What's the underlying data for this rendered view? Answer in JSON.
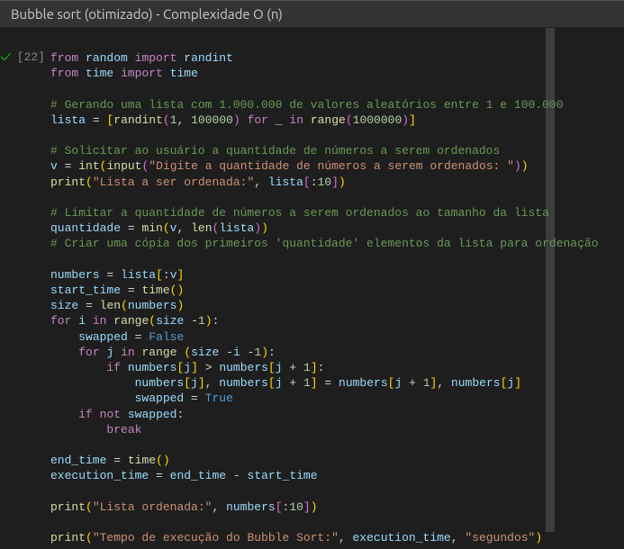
{
  "header": {
    "title": "Bubble sort (otimizado) - Complexidade O (n)"
  },
  "cell": {
    "execution_count_label": "[22]",
    "status_icon": "check",
    "code_tokens": [
      [
        [
          "kw",
          "from"
        ],
        [
          "op",
          " "
        ],
        [
          "var",
          "random"
        ],
        [
          "op",
          " "
        ],
        [
          "kw",
          "import"
        ],
        [
          "op",
          " "
        ],
        [
          "var",
          "randint"
        ]
      ],
      [
        [
          "kw",
          "from"
        ],
        [
          "op",
          " "
        ],
        [
          "var",
          "time"
        ],
        [
          "op",
          " "
        ],
        [
          "kw",
          "import"
        ],
        [
          "op",
          " "
        ],
        [
          "var",
          "time"
        ]
      ],
      [],
      [
        [
          "cmt",
          "# Gerando uma lista com 1.000.000 de valores aleatórios entre 1 e 100.000"
        ]
      ],
      [
        [
          "var",
          "lista"
        ],
        [
          "op",
          " "
        ],
        [
          "op",
          "="
        ],
        [
          "op",
          " "
        ],
        [
          "par",
          "["
        ],
        [
          "fn",
          "randint"
        ],
        [
          "brk",
          "("
        ],
        [
          "num",
          "1"
        ],
        [
          "op",
          ","
        ],
        [
          "op",
          " "
        ],
        [
          "num",
          "100000"
        ],
        [
          "brk",
          ")"
        ],
        [
          "op",
          " "
        ],
        [
          "kw",
          "for"
        ],
        [
          "op",
          " "
        ],
        [
          "var",
          "_"
        ],
        [
          "op",
          " "
        ],
        [
          "kw",
          "in"
        ],
        [
          "op",
          " "
        ],
        [
          "fn",
          "range"
        ],
        [
          "brk",
          "("
        ],
        [
          "num",
          "1000000"
        ],
        [
          "brk",
          ")"
        ],
        [
          "par",
          "]"
        ]
      ],
      [],
      [
        [
          "cmt",
          "# Solicitar ao usuário a quantidade de números a serem ordenados"
        ]
      ],
      [
        [
          "var",
          "v"
        ],
        [
          "op",
          " "
        ],
        [
          "op",
          "="
        ],
        [
          "op",
          " "
        ],
        [
          "fn",
          "int"
        ],
        [
          "par",
          "("
        ],
        [
          "fn",
          "input"
        ],
        [
          "brk",
          "("
        ],
        [
          "str",
          "\"Digite a quantidade de números a serem ordenados: \""
        ],
        [
          "brk",
          ")"
        ],
        [
          "par",
          ")"
        ]
      ],
      [
        [
          "fn",
          "print"
        ],
        [
          "par",
          "("
        ],
        [
          "str",
          "\"Lista a ser ordenada:\""
        ],
        [
          "op",
          ","
        ],
        [
          "op",
          " "
        ],
        [
          "var",
          "lista"
        ],
        [
          "brk",
          "["
        ],
        [
          "op",
          ":"
        ],
        [
          "num",
          "10"
        ],
        [
          "brk",
          "]"
        ],
        [
          "par",
          ")"
        ]
      ],
      [],
      [
        [
          "cmt",
          "# Limitar a quantidade de números a serem ordenados ao tamanho da lista"
        ]
      ],
      [
        [
          "var",
          "quantidade"
        ],
        [
          "op",
          " "
        ],
        [
          "op",
          "="
        ],
        [
          "op",
          " "
        ],
        [
          "fn",
          "min"
        ],
        [
          "par",
          "("
        ],
        [
          "var",
          "v"
        ],
        [
          "op",
          ","
        ],
        [
          "op",
          " "
        ],
        [
          "fn",
          "len"
        ],
        [
          "brk",
          "("
        ],
        [
          "var",
          "lista"
        ],
        [
          "brk",
          ")"
        ],
        [
          "par",
          ")"
        ]
      ],
      [
        [
          "cmt",
          "# Criar uma cópia dos primeiros 'quantidade' elementos da lista para ordenação"
        ]
      ],
      [],
      [
        [
          "var",
          "numbers"
        ],
        [
          "op",
          " "
        ],
        [
          "op",
          "="
        ],
        [
          "op",
          " "
        ],
        [
          "var",
          "lista"
        ],
        [
          "par",
          "["
        ],
        [
          "op",
          ":"
        ],
        [
          "var",
          "v"
        ],
        [
          "par",
          "]"
        ]
      ],
      [
        [
          "var",
          "start_time"
        ],
        [
          "op",
          " "
        ],
        [
          "op",
          "="
        ],
        [
          "op",
          " "
        ],
        [
          "fn",
          "time"
        ],
        [
          "par",
          "("
        ],
        [
          "par",
          ")"
        ]
      ],
      [
        [
          "var",
          "size"
        ],
        [
          "op",
          " "
        ],
        [
          "op",
          "="
        ],
        [
          "op",
          " "
        ],
        [
          "fn",
          "len"
        ],
        [
          "par",
          "("
        ],
        [
          "var",
          "numbers"
        ],
        [
          "par",
          ")"
        ]
      ],
      [
        [
          "kw",
          "for"
        ],
        [
          "op",
          " "
        ],
        [
          "var",
          "i"
        ],
        [
          "op",
          " "
        ],
        [
          "kw",
          "in"
        ],
        [
          "op",
          " "
        ],
        [
          "fn",
          "range"
        ],
        [
          "par",
          "("
        ],
        [
          "var",
          "size"
        ],
        [
          "op",
          " "
        ],
        [
          "op",
          "-"
        ],
        [
          "num",
          "1"
        ],
        [
          "par",
          ")"
        ],
        [
          "op",
          ":"
        ]
      ],
      [
        [
          "op",
          "    "
        ],
        [
          "var",
          "swapped"
        ],
        [
          "op",
          " "
        ],
        [
          "op",
          "="
        ],
        [
          "op",
          " "
        ],
        [
          "bool",
          "False"
        ]
      ],
      [
        [
          "op",
          "    "
        ],
        [
          "kw",
          "for"
        ],
        [
          "op",
          " "
        ],
        [
          "var",
          "j"
        ],
        [
          "op",
          " "
        ],
        [
          "kw",
          "in"
        ],
        [
          "op",
          " "
        ],
        [
          "fn",
          "range"
        ],
        [
          "op",
          " "
        ],
        [
          "par",
          "("
        ],
        [
          "var",
          "size"
        ],
        [
          "op",
          " "
        ],
        [
          "op",
          "-"
        ],
        [
          "var",
          "i"
        ],
        [
          "op",
          " "
        ],
        [
          "op",
          "-"
        ],
        [
          "num",
          "1"
        ],
        [
          "par",
          ")"
        ],
        [
          "op",
          ":"
        ]
      ],
      [
        [
          "op",
          "        "
        ],
        [
          "kw",
          "if"
        ],
        [
          "op",
          " "
        ],
        [
          "var",
          "numbers"
        ],
        [
          "par",
          "["
        ],
        [
          "var",
          "j"
        ],
        [
          "par",
          "]"
        ],
        [
          "op",
          " "
        ],
        [
          "op",
          ">"
        ],
        [
          "op",
          " "
        ],
        [
          "var",
          "numbers"
        ],
        [
          "par",
          "["
        ],
        [
          "var",
          "j"
        ],
        [
          "op",
          " "
        ],
        [
          "op",
          "+"
        ],
        [
          "op",
          " "
        ],
        [
          "num",
          "1"
        ],
        [
          "par",
          "]"
        ],
        [
          "op",
          ":"
        ]
      ],
      [
        [
          "op",
          "            "
        ],
        [
          "var",
          "numbers"
        ],
        [
          "par",
          "["
        ],
        [
          "var",
          "j"
        ],
        [
          "par",
          "]"
        ],
        [
          "op",
          ","
        ],
        [
          "op",
          " "
        ],
        [
          "var",
          "numbers"
        ],
        [
          "par",
          "["
        ],
        [
          "var",
          "j"
        ],
        [
          "op",
          " "
        ],
        [
          "op",
          "+"
        ],
        [
          "op",
          " "
        ],
        [
          "num",
          "1"
        ],
        [
          "par",
          "]"
        ],
        [
          "op",
          " "
        ],
        [
          "op",
          "="
        ],
        [
          "op",
          " "
        ],
        [
          "var",
          "numbers"
        ],
        [
          "par",
          "["
        ],
        [
          "var",
          "j"
        ],
        [
          "op",
          " "
        ],
        [
          "op",
          "+"
        ],
        [
          "op",
          " "
        ],
        [
          "num",
          "1"
        ],
        [
          "par",
          "]"
        ],
        [
          "op",
          ","
        ],
        [
          "op",
          " "
        ],
        [
          "var",
          "numbers"
        ],
        [
          "par",
          "["
        ],
        [
          "var",
          "j"
        ],
        [
          "par",
          "]"
        ]
      ],
      [
        [
          "op",
          "            "
        ],
        [
          "var",
          "swapped"
        ],
        [
          "op",
          " "
        ],
        [
          "op",
          "="
        ],
        [
          "op",
          " "
        ],
        [
          "bool",
          "True"
        ]
      ],
      [
        [
          "op",
          "    "
        ],
        [
          "kw",
          "if"
        ],
        [
          "op",
          " "
        ],
        [
          "kw",
          "not"
        ],
        [
          "op",
          " "
        ],
        [
          "var",
          "swapped"
        ],
        [
          "op",
          ":"
        ]
      ],
      [
        [
          "op",
          "        "
        ],
        [
          "kw",
          "break"
        ]
      ],
      [],
      [
        [
          "var",
          "end_time"
        ],
        [
          "op",
          " "
        ],
        [
          "op",
          "="
        ],
        [
          "op",
          " "
        ],
        [
          "fn",
          "time"
        ],
        [
          "par",
          "("
        ],
        [
          "par",
          ")"
        ]
      ],
      [
        [
          "var",
          "execution_time"
        ],
        [
          "op",
          " "
        ],
        [
          "op",
          "="
        ],
        [
          "op",
          " "
        ],
        [
          "var",
          "end_time"
        ],
        [
          "op",
          " "
        ],
        [
          "op",
          "-"
        ],
        [
          "op",
          " "
        ],
        [
          "var",
          "start_time"
        ]
      ],
      [],
      [
        [
          "fn",
          "print"
        ],
        [
          "par",
          "("
        ],
        [
          "str",
          "\"Lista ordenada:\""
        ],
        [
          "op",
          ","
        ],
        [
          "op",
          " "
        ],
        [
          "var",
          "numbers"
        ],
        [
          "brk",
          "["
        ],
        [
          "op",
          ":"
        ],
        [
          "num",
          "10"
        ],
        [
          "brk",
          "]"
        ],
        [
          "par",
          ")"
        ]
      ],
      [],
      [
        [
          "fn",
          "print"
        ],
        [
          "par",
          "("
        ],
        [
          "str",
          "\"Tempo de execução do Bubble Sort:\""
        ],
        [
          "op",
          ","
        ],
        [
          "op",
          " "
        ],
        [
          "var",
          "execution_time"
        ],
        [
          "op",
          ","
        ],
        [
          "op",
          " "
        ],
        [
          "str",
          "\"segundos\""
        ],
        [
          "par",
          ")"
        ]
      ]
    ]
  }
}
